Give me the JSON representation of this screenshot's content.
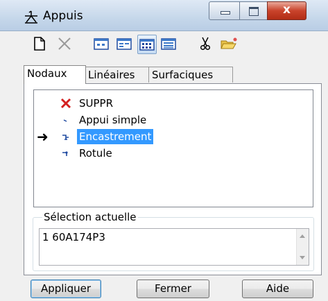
{
  "window": {
    "title": "Appuis",
    "icon": "supports-icon",
    "buttons": {
      "minimize": "minimize-icon",
      "maximize": "maximize-icon",
      "close": "x"
    }
  },
  "toolbar": {
    "items": [
      "new-icon",
      "delete-icon",
      "view-small-icon",
      "view-list-icon",
      "view-grid-icon",
      "view-details-icon",
      "scissors-icon",
      "folder-open-icon"
    ],
    "active_item": "view-grid-icon"
  },
  "tabs": [
    {
      "label": "Nodaux",
      "selected": true
    },
    {
      "label": "Linéaires",
      "selected": false
    },
    {
      "label": "Surfaciques",
      "selected": false
    }
  ],
  "list": {
    "items": [
      {
        "label": "SUPPR",
        "icon": "red-x-icon"
      },
      {
        "label": "Appui simple",
        "icon": "simple-support-icon"
      },
      {
        "label": "Encastrement",
        "icon": "fixed-support-icon",
        "selected": true,
        "current": true
      },
      {
        "label": "Rotule",
        "icon": "hinge-icon"
      }
    ]
  },
  "selection": {
    "title": "Sélection actuelle",
    "value": "1 60A174P3"
  },
  "footer": {
    "apply": "Appliquer",
    "close": "Fermer",
    "help": "Aide"
  },
  "colors": {
    "selection": "#3399ff",
    "delete": "#d42020",
    "icon_blue": "#1f4aa0"
  }
}
